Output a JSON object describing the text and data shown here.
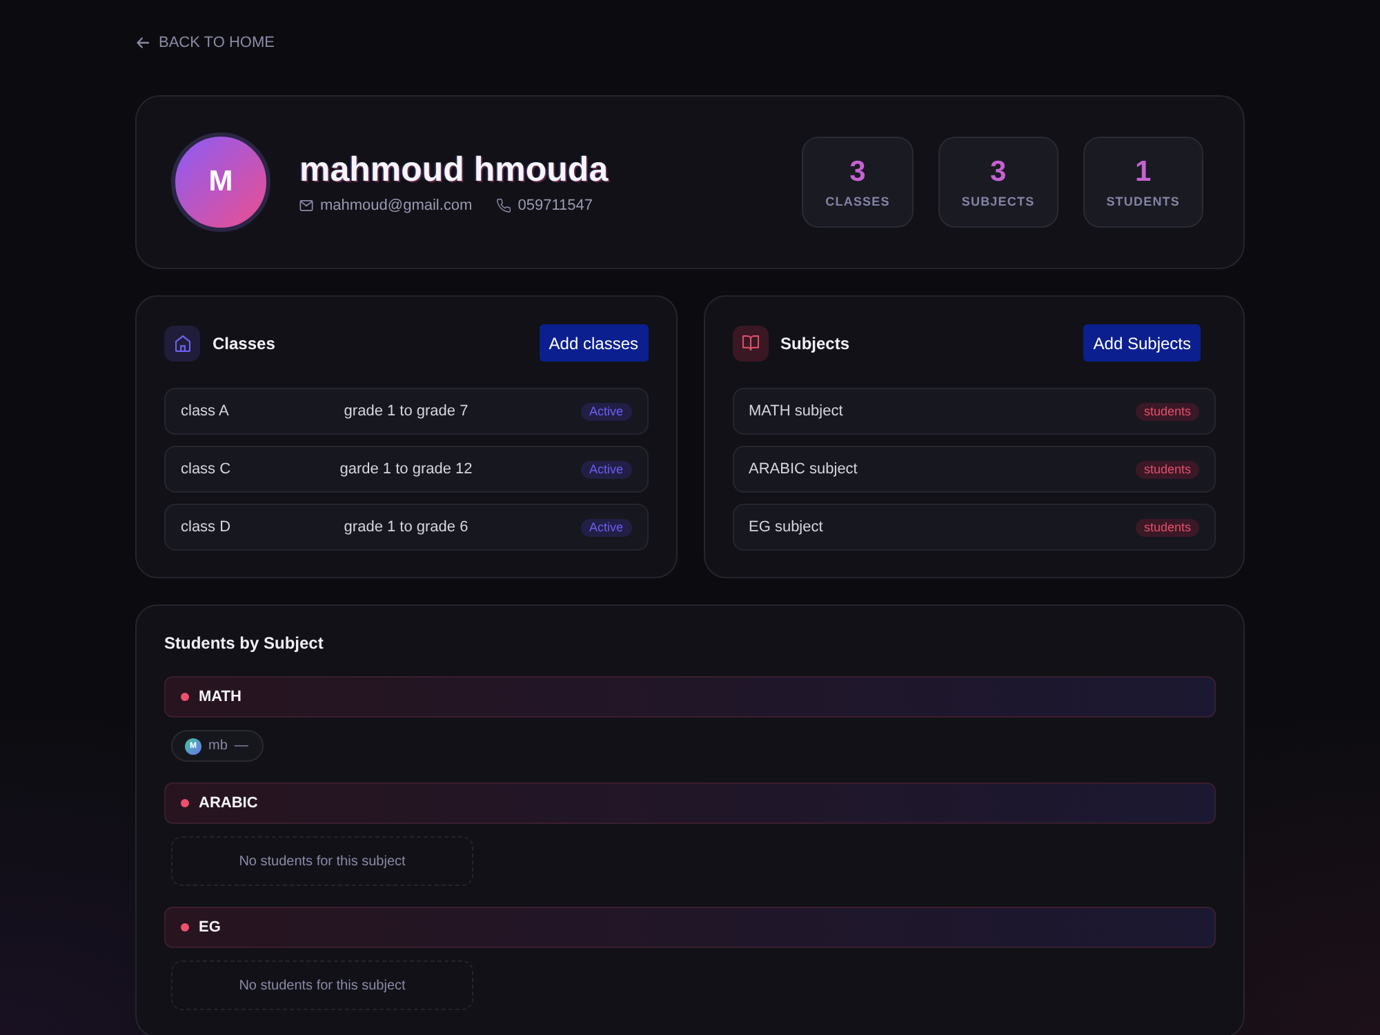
{
  "back_link": {
    "label": "BACK TO HOME"
  },
  "profile": {
    "avatar_letter": "M",
    "name": "mahmoud hmouda",
    "email": "mahmoud@gmail.com",
    "phone": "059711547"
  },
  "stats": [
    {
      "value": "3",
      "label": "CLASSES"
    },
    {
      "value": "3",
      "label": "SUBJECTS"
    },
    {
      "value": "1",
      "label": "STUDENTS"
    }
  ],
  "classes": {
    "title": "Classes",
    "button": "Add classes",
    "rows": [
      {
        "name": "class A",
        "grades": "grade 1 to grade 7",
        "status": "Active"
      },
      {
        "name": "class C",
        "grades": "garde 1 to grade 12",
        "status": "Active"
      },
      {
        "name": "class D",
        "grades": "grade 1 to grade 6",
        "status": "Active"
      }
    ]
  },
  "subjects": {
    "title": "Subjects",
    "button": "Add Subjects",
    "rows": [
      {
        "name": "MATH subject",
        "badge": "students"
      },
      {
        "name": "ARABIC subject",
        "badge": "students"
      },
      {
        "name": "EG subject",
        "badge": "students"
      }
    ]
  },
  "students_by_subject": {
    "title": "Students by Subject",
    "groups": [
      {
        "subject": "MATH",
        "students": [
          {
            "avatar_letter": "M",
            "name": "mb",
            "detail": "—"
          }
        ]
      },
      {
        "subject": "ARABIC",
        "empty_text": "No students for this subject"
      },
      {
        "subject": "EG",
        "empty_text": "No students for this subject"
      }
    ]
  }
}
